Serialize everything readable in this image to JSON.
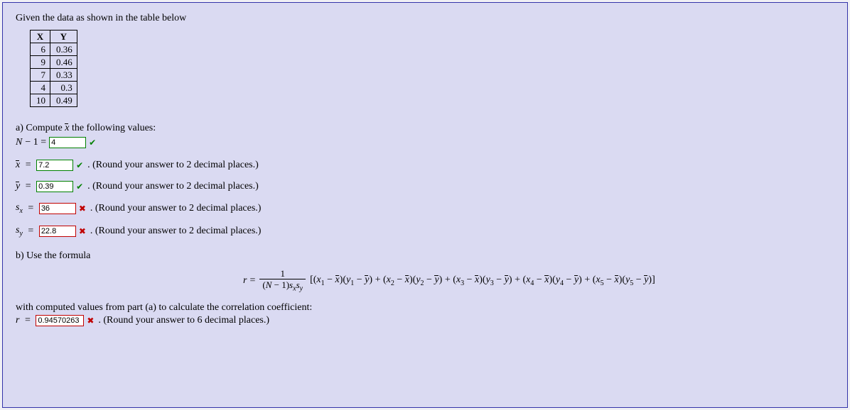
{
  "intro": "Given the data as shown in the table below",
  "table": {
    "headers": [
      "X",
      "Y"
    ],
    "rows": [
      [
        "6",
        "0.36"
      ],
      [
        "9",
        "0.46"
      ],
      [
        "7",
        "0.33"
      ],
      [
        "4",
        "0.3"
      ],
      [
        "10",
        "0.49"
      ]
    ]
  },
  "partA": {
    "prompt_prefix": "a) Compute ",
    "prompt_suffix": " the following values:",
    "n_minus_1": {
      "label_left": "N",
      "label_mid": " − 1 = ",
      "value": "4",
      "status": "correct"
    },
    "xbar": {
      "value": "7.2",
      "status": "correct",
      "hint": ". (Round your answer to 2 decimal places.)"
    },
    "ybar": {
      "value": "0.39",
      "status": "correct",
      "hint": ". (Round your answer to 2 decimal places.)"
    },
    "sx": {
      "value": "36",
      "status": "wrong",
      "hint": ". (Round your answer to 2 decimal places.)"
    },
    "sy": {
      "value": "22.8",
      "status": "wrong",
      "hint": ". (Round your answer to 2 decimal places.)"
    }
  },
  "partB": {
    "prompt": "b) Use the formula",
    "postformula": "with computed values from part (a) to calculate the correlation coefficient:",
    "r": {
      "value": "0.94570263",
      "status": "wrong",
      "hint": ". (Round your answer to 6 decimal places.)"
    }
  },
  "formula": {
    "lead": "r = ",
    "num": "1",
    "den_plain": "(N − 1)s",
    "bracket": "[(x₁ − x̄)(y₁ − ȳ) + (x₂ − x̄)(y₂ − ȳ) + (x₃ − x̄)(y₃ − ȳ) + (x₄ − x̄)(y₄ − ȳ) + (x₅ − x̄)(y₅ − ȳ)]"
  }
}
